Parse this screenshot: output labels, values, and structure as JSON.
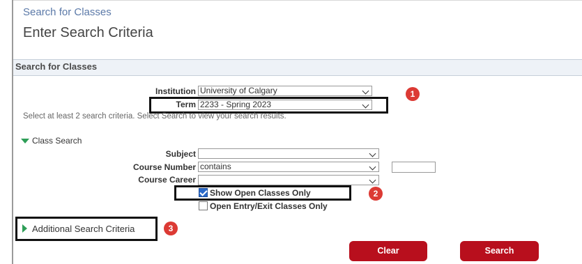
{
  "header": {
    "breadcrumb": "Search for Classes",
    "title": "Enter Search Criteria"
  },
  "section": {
    "title": "Search for Classes"
  },
  "form": {
    "institution_label": "Institution",
    "institution_value": "University of Calgary",
    "term_label": "Term",
    "term_value": "2233 - Spring 2023",
    "hint": "Select at least 2 search criteria. Select Search to view your search results.",
    "class_search_label": "Class Search",
    "subject_label": "Subject",
    "subject_value": "",
    "course_number_label": "Course Number",
    "course_number_value": "contains",
    "course_career_label": "Course Career",
    "course_career_value": "",
    "show_open_label": "Show Open Classes Only",
    "show_open_checked": true,
    "open_entry_label": "Open Entry/Exit Classes Only",
    "open_entry_checked": false,
    "additional_label": "Additional Search Criteria"
  },
  "callouts": [
    "1",
    "2",
    "3"
  ],
  "buttons": {
    "clear": "Clear",
    "search": "Search"
  },
  "colors": {
    "accent_red": "#b80f1d",
    "badge_red": "#dc3a34",
    "link_blue": "#5b79a8",
    "expand_green": "#2e9e57",
    "checkbox_blue": "#2a69c9"
  },
  "icons": {
    "expand": "triangle-down-icon",
    "collapse": "triangle-right-icon",
    "dropdown": "chevron-down-icon",
    "check": "check-icon"
  }
}
